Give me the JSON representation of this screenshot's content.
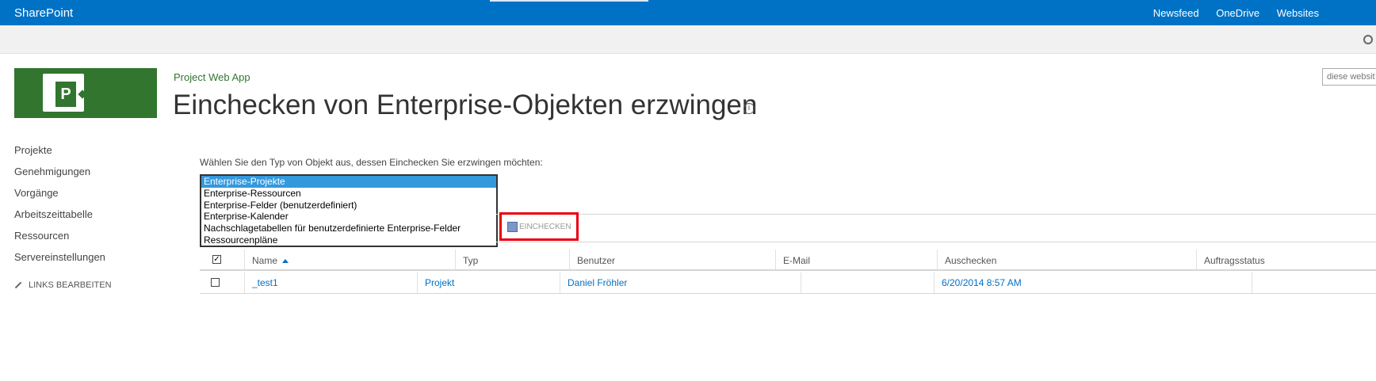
{
  "suitebar": {
    "brand": "SharePoint",
    "links": [
      "Newsfeed",
      "OneDrive",
      "Websites"
    ]
  },
  "site": {
    "name": "Project Web App",
    "title": "Einchecken von Enterprise-Objekten erzwingen",
    "search_placeholder": "diese websit"
  },
  "nav": {
    "items": [
      "Projekte",
      "Genehmigungen",
      "Vorgänge",
      "Arbeitszeittabelle",
      "Ressourcen",
      "Servereinstellungen"
    ],
    "edit_links": "LINKS BEARBEITEN"
  },
  "main": {
    "prompt": "Wählen Sie den Typ von Objekt aus, dessen Einchecken Sie erzwingen möchten:",
    "object_types": [
      "Enterprise-Projekte",
      "Enterprise-Ressourcen",
      "Enterprise-Felder (benutzerdefiniert)",
      "Enterprise-Kalender",
      "Nachschlagetabellen für benutzerdefinierte Enterprise-Felder",
      "Ressourcenpläne"
    ],
    "selected_index": 0,
    "checkin_label": "EINCHECKEN"
  },
  "grid": {
    "columns": [
      "Name",
      "Typ",
      "Benutzer",
      "E-Mail",
      "Auschecken",
      "Auftragsstatus"
    ],
    "rows": [
      {
        "name": "_test1",
        "type": "Projekt",
        "user": "Daniel Fröhler",
        "email": "",
        "checkout": "6/20/2014 8:57 AM",
        "status": ""
      }
    ]
  },
  "colors": {
    "suitebar": "#0072c6",
    "logo": "#31752f",
    "highlight": "#e8000d",
    "selection": "#3399dd"
  }
}
